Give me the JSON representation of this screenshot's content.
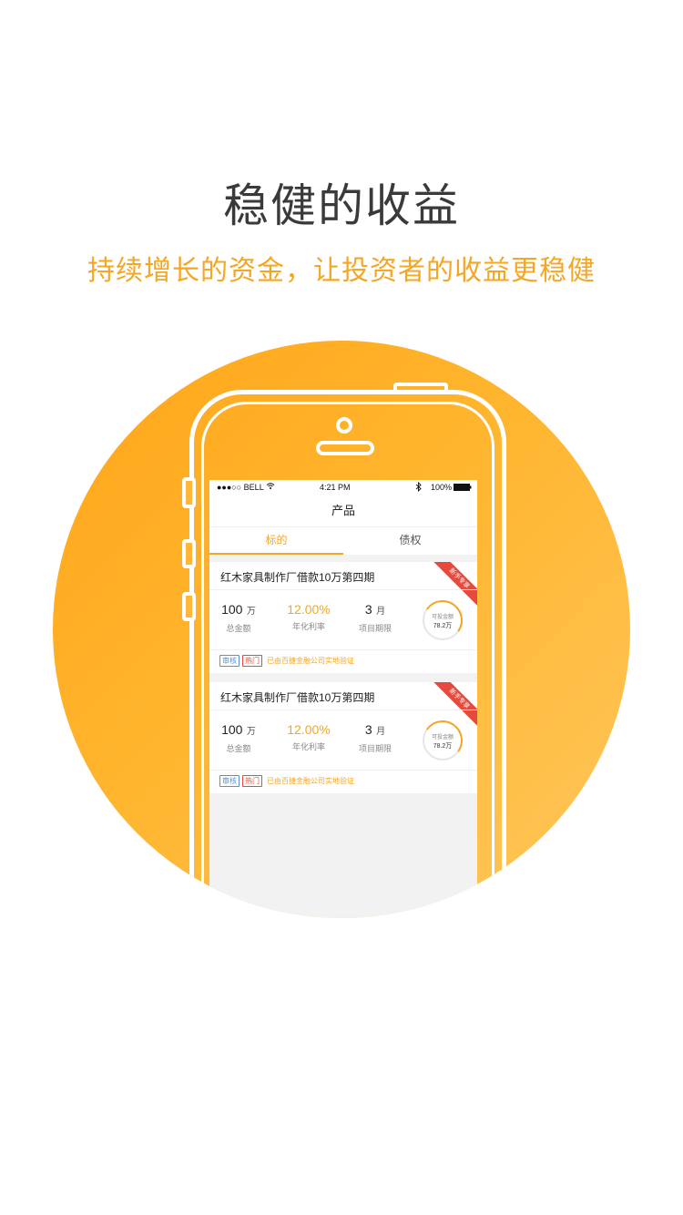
{
  "header": {
    "title": "稳健的收益",
    "subtitle": "持续增长的资金，让投资者的收益更稳健"
  },
  "colors": {
    "accent": "#f5a623",
    "circle": "#ffad26",
    "ribbon": "#e64a3c",
    "audit_tag": "#5b8fd6"
  },
  "phone": {
    "statusbar": {
      "carrier": "●●●○○ BELL",
      "time": "4:21 PM",
      "battery": "100%"
    },
    "nav_title": "产品",
    "tabs": [
      {
        "label": "标的",
        "active": true
      },
      {
        "label": "债权",
        "active": false
      }
    ],
    "cards": [
      {
        "title": "红木家具制作厂借款10万第四期",
        "ribbon": "新手专享",
        "amount_value": "100",
        "amount_unit": "万",
        "amount_label": "总金额",
        "rate_value": "12.00%",
        "rate_label": "年化利率",
        "term_value": "3",
        "term_unit": "月",
        "term_label": "项目期限",
        "ring_label": "可投金额",
        "ring_value": "78.2万",
        "tag_audit": "审核",
        "tag_hot": "热门",
        "verify_text": "已由百捷金融公司实地验证"
      },
      {
        "title": "红木家具制作厂借款10万第四期",
        "ribbon": "新手专享",
        "amount_value": "100",
        "amount_unit": "万",
        "amount_label": "总金额",
        "rate_value": "12.00%",
        "rate_label": "年化利率",
        "term_value": "3",
        "term_unit": "月",
        "term_label": "项目期限",
        "ring_label": "可投金额",
        "ring_value": "78.2万",
        "tag_audit": "审核",
        "tag_hot": "热门",
        "verify_text": "已由百捷金融公司实地验证"
      }
    ]
  }
}
